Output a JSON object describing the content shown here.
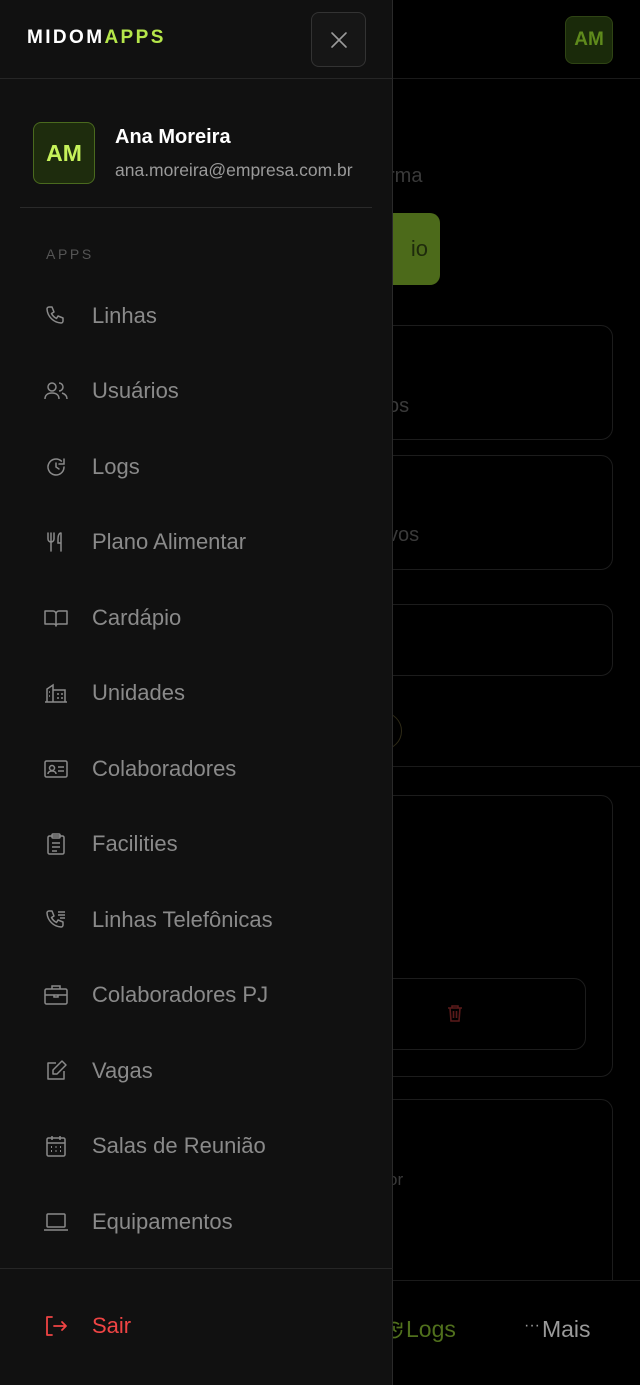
{
  "brand": {
    "part1": "MIDOM",
    "part2": "APPS"
  },
  "background": {
    "avatar": "AM",
    "snippet1": "rma",
    "button_fragment": "io",
    "snippet2": "os",
    "snippet3": "vos",
    "snippet4": "or",
    "bottom_nav": {
      "logs": "Logs",
      "more": "Mais"
    }
  },
  "user": {
    "initials": "AM",
    "name": "Ana Moreira",
    "email": "ana.moreira@empresa.com.br"
  },
  "section": "APPS",
  "menu": [
    {
      "label": "Linhas",
      "icon": "phone-icon"
    },
    {
      "label": "Usuários",
      "icon": "users-icon"
    },
    {
      "label": "Logs",
      "icon": "history-icon"
    },
    {
      "label": "Plano Alimentar",
      "icon": "utensils-icon"
    },
    {
      "label": "Cardápio",
      "icon": "book-open-icon"
    },
    {
      "label": "Unidades",
      "icon": "building-icon"
    },
    {
      "label": "Colaboradores",
      "icon": "id-card-icon"
    },
    {
      "label": "Facilities",
      "icon": "clipboard-icon"
    },
    {
      "label": "Linhas Telefônicas",
      "icon": "phone-list-icon"
    },
    {
      "label": "Colaboradores PJ",
      "icon": "briefcase-icon"
    },
    {
      "label": "Vagas",
      "icon": "edit-icon"
    },
    {
      "label": "Salas de Reunião",
      "icon": "calendar-icon"
    },
    {
      "label": "Equipamentos",
      "icon": "laptop-icon"
    }
  ],
  "logout": {
    "label": "Sair",
    "icon": "logout-icon"
  },
  "colors": {
    "accent": "#b5e64a",
    "danger": "#ef4444",
    "drawer_bg": "#111111"
  }
}
